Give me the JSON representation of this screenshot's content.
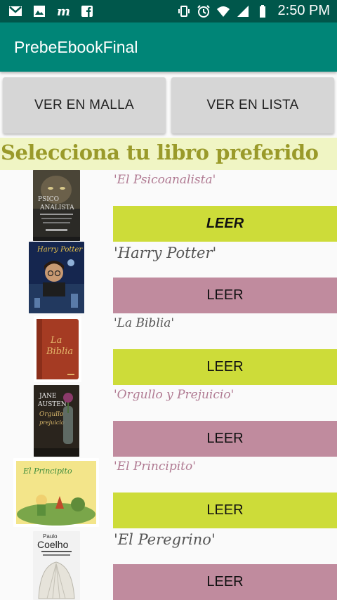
{
  "status_bar": {
    "time": "2:50 PM",
    "left_icons": [
      "gmail-icon",
      "image-icon",
      "m-app-icon",
      "facebook-icon"
    ],
    "right_icons": [
      "vibrate-icon",
      "alarm-icon",
      "wifi-icon",
      "signal-icon",
      "battery-icon"
    ]
  },
  "app_bar": {
    "title": "PrebeEbookFinal",
    "color": "#008577"
  },
  "view_buttons": {
    "grid_label": "VER EN MALLA",
    "list_label": "VER EN LISTA"
  },
  "heading": "Selecciona tu libro preferido",
  "books": [
    {
      "title": "'El Psicoanalista'",
      "button": "LEER",
      "button_color": "#cddc39",
      "cover": "el-psicoanalista-cover"
    },
    {
      "title": "'Harry Potter'",
      "button": "LEER",
      "button_color": "#c08b9e",
      "cover": "harry-potter-cover"
    },
    {
      "title": "'La Biblia'",
      "button": "LEER",
      "button_color": "#cddc39",
      "cover": "la-biblia-cover"
    },
    {
      "title": "'Orgullo y Prejuicio'",
      "button": "LEER",
      "button_color": "#c08b9e",
      "cover": "orgullo-y-prejuicio-cover"
    },
    {
      "title": "'El Principito'",
      "button": "LEER",
      "button_color": "#cddc39",
      "cover": "el-principito-cover"
    },
    {
      "title": "'El Peregrino'",
      "button": "LEER",
      "button_color": "#c08b9e",
      "cover": "el-peregrino-cover"
    }
  ]
}
